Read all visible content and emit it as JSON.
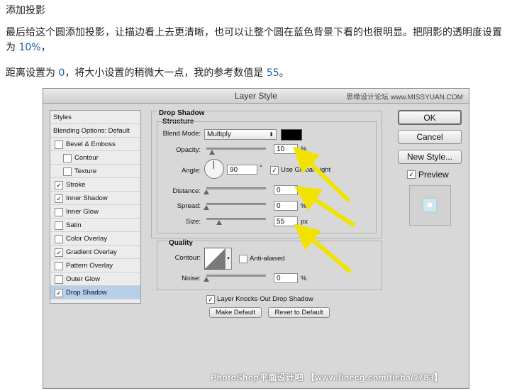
{
  "article": {
    "heading": "添加投影",
    "p1_a": "最后给这个圆添加投影，让描边看上去更清晰，也可以让整个圆在蓝色背景下看的也很明显。把阴影的透明度设置为 ",
    "p1_b": "10%",
    "p1_c": "，",
    "p2_a": "距离设置为 ",
    "p2_b": "0",
    "p2_c": "，将大小设置的稍微大一点，我的参考数值是 ",
    "p2_d": "55",
    "p2_e": "。"
  },
  "dialog": {
    "title": "Layer Style",
    "watermark_top": "思缘设计论坛 www.MISSYUAN.COM",
    "watermark_bottom": "PhotoShop平面设计吧 【www.linecg.com/tieba/1783】",
    "styles_list": [
      {
        "label": "Styles",
        "checkbox": false,
        "checked": false,
        "selected": false,
        "indent": 0
      },
      {
        "label": "Blending Options: Default",
        "checkbox": false,
        "checked": false,
        "selected": false,
        "indent": 0
      },
      {
        "label": "Bevel & Emboss",
        "checkbox": true,
        "checked": false,
        "selected": false,
        "indent": 0
      },
      {
        "label": "Contour",
        "checkbox": true,
        "checked": false,
        "selected": false,
        "indent": 1
      },
      {
        "label": "Texture",
        "checkbox": true,
        "checked": false,
        "selected": false,
        "indent": 1
      },
      {
        "label": "Stroke",
        "checkbox": true,
        "checked": true,
        "selected": false,
        "indent": 0
      },
      {
        "label": "Inner Shadow",
        "checkbox": true,
        "checked": true,
        "selected": false,
        "indent": 0
      },
      {
        "label": "Inner Glow",
        "checkbox": true,
        "checked": false,
        "selected": false,
        "indent": 0
      },
      {
        "label": "Satin",
        "checkbox": true,
        "checked": false,
        "selected": false,
        "indent": 0
      },
      {
        "label": "Color Overlay",
        "checkbox": true,
        "checked": false,
        "selected": false,
        "indent": 0
      },
      {
        "label": "Gradient Overlay",
        "checkbox": true,
        "checked": true,
        "selected": false,
        "indent": 0
      },
      {
        "label": "Pattern Overlay",
        "checkbox": true,
        "checked": false,
        "selected": false,
        "indent": 0
      },
      {
        "label": "Outer Glow",
        "checkbox": true,
        "checked": false,
        "selected": false,
        "indent": 0
      },
      {
        "label": "Drop Shadow",
        "checkbox": true,
        "checked": true,
        "selected": true,
        "indent": 0
      }
    ],
    "drop_shadow": {
      "section_title": "Drop Shadow",
      "structure_title": "Structure",
      "blend_mode_label": "Blend Mode:",
      "blend_mode_value": "Multiply",
      "shadow_color": "#000000",
      "opacity_label": "Opacity:",
      "opacity_value": "10",
      "opacity_unit": "%",
      "opacity_level": 0.1,
      "angle_label": "Angle:",
      "angle_value": "90",
      "angle_unit": "°",
      "use_global_light_label": "Use Global Light",
      "use_global_light_checked": true,
      "distance_label": "Distance:",
      "distance_value": "0",
      "distance_unit": "px",
      "distance_level": 0,
      "spread_label": "Spread:",
      "spread_value": "0",
      "spread_unit": "%",
      "spread_level": 0,
      "size_label": "Size:",
      "size_value": "55",
      "size_unit": "px",
      "size_level": 0.22,
      "quality_title": "Quality",
      "contour_label": "Contour:",
      "anti_aliased_label": "Anti-aliased",
      "anti_aliased_checked": false,
      "noise_label": "Noise:",
      "noise_value": "0",
      "noise_unit": "%",
      "noise_level": 0,
      "knocks_out_label": "Layer Knocks Out Drop Shadow",
      "knocks_out_checked": true,
      "make_default_label": "Make Default",
      "reset_default_label": "Reset to Default"
    },
    "buttons": {
      "ok": "OK",
      "cancel": "Cancel",
      "new_style": "New Style...",
      "preview_label": "Preview",
      "preview_checked": true
    },
    "colors": {
      "highlight_text": "#1a5fa8",
      "arrow": "#f2e200",
      "selected_row": "#b6d0ea"
    }
  }
}
